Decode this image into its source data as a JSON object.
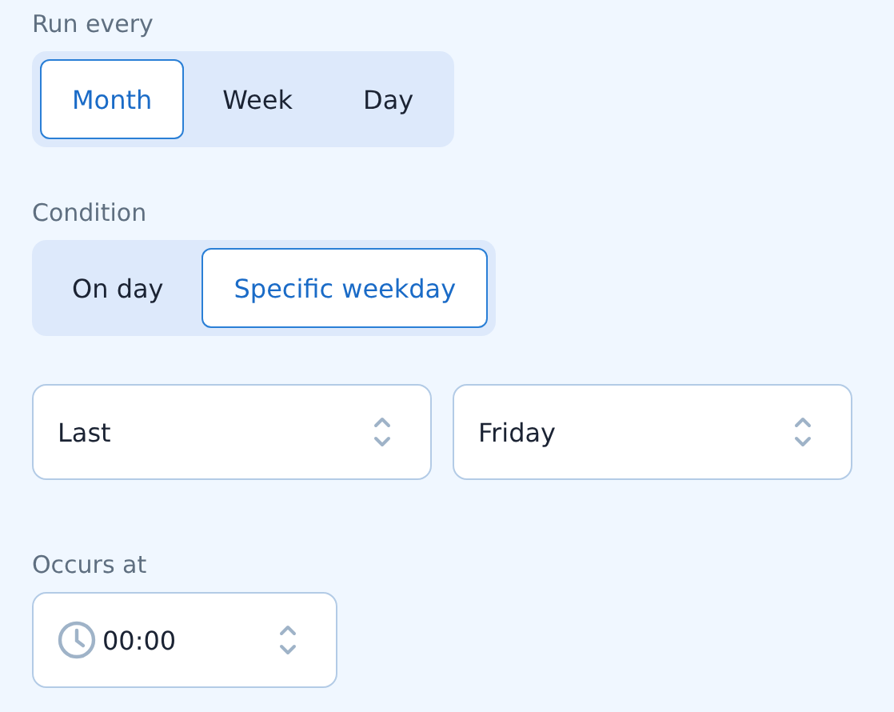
{
  "run_every": {
    "label": "Run every",
    "options": [
      {
        "label": "Month",
        "selected": true
      },
      {
        "label": "Week",
        "selected": false
      },
      {
        "label": "Day",
        "selected": false
      }
    ]
  },
  "condition": {
    "label": "Condition",
    "options": [
      {
        "label": "On day",
        "selected": false
      },
      {
        "label": "Specific weekday",
        "selected": true
      }
    ]
  },
  "selects": [
    {
      "value": "Last"
    },
    {
      "value": "Friday"
    }
  ],
  "occurs_at": {
    "label": "Occurs at",
    "value": "00:00"
  }
}
